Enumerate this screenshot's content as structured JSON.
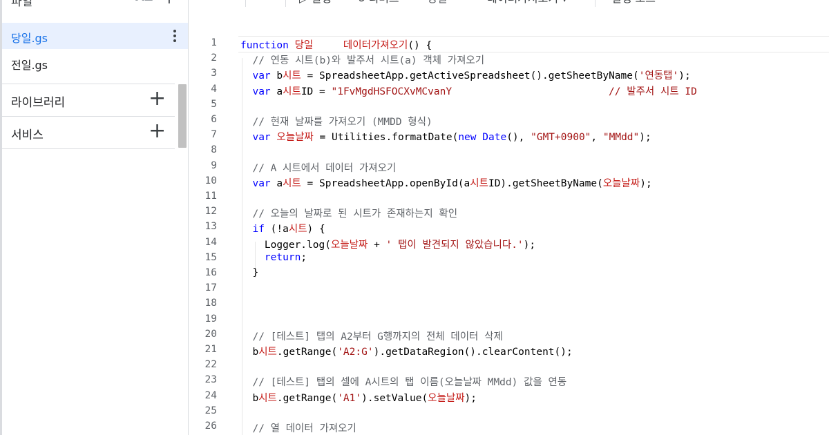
{
  "sidebar": {
    "files_label": "파일",
    "sort_label": "AZ",
    "add_label": "+",
    "files": [
      {
        "name": "당일.gs",
        "active": true
      },
      {
        "name": "전일.gs",
        "active": false
      }
    ],
    "sections": [
      {
        "name": "라이브러리",
        "add": "+"
      },
      {
        "name": "서비스",
        "add": "+"
      }
    ]
  },
  "toolbar": {
    "undo": "↶",
    "redo": "↷",
    "save": "⎙",
    "run": "▷ 실행",
    "debug": "⟲ 디버그",
    "bind": "평일",
    "function_select": "데이터가져오기 ▾",
    "log": "실행 로그"
  },
  "editor": {
    "current_line": 1,
    "lines": [
      {
        "n": "1",
        "code": "function 당일     데이터가져오기() {"
      },
      {
        "n": "2",
        "code": "  // 연동 시트(b)와 발주서 시트(a) 객체 가져오기"
      },
      {
        "n": "3",
        "code": "  var b시트 = SpreadsheetApp.getActiveSpreadsheet().getSheetByName('연동탭');"
      },
      {
        "n": "4",
        "code": "  var a시트ID = \"1FvMgdHSFOCXvMCvanY                          // 발주서 시트 ID"
      },
      {
        "n": "5",
        "code": ""
      },
      {
        "n": "6",
        "code": "  // 현재 날짜를 가져오기 (MMDD 형식)"
      },
      {
        "n": "7",
        "code": "  var 오늘날짜 = Utilities.formatDate(new Date(), \"GMT+0900\", \"MMdd\");"
      },
      {
        "n": "8",
        "code": ""
      },
      {
        "n": "9",
        "code": "  // A 시트에서 데이터 가져오기"
      },
      {
        "n": "10",
        "code": "  var a시트 = SpreadsheetApp.openById(a시트ID).getSheetByName(오늘날짜);"
      },
      {
        "n": "11",
        "code": ""
      },
      {
        "n": "12",
        "code": "  // 오늘의 날짜로 된 시트가 존재하는지 확인"
      },
      {
        "n": "13",
        "code": "  if (!a시트) {"
      },
      {
        "n": "14",
        "code": "    Logger.log(오늘날짜 + ' 탭이 발견되지 않았습니다.');"
      },
      {
        "n": "15",
        "code": "    return;"
      },
      {
        "n": "16",
        "code": "  }"
      },
      {
        "n": "17",
        "code": ""
      },
      {
        "n": "18",
        "code": ""
      },
      {
        "n": "19",
        "code": ""
      },
      {
        "n": "20",
        "code": "  // [테스트] 탭의 A2부터 G행까지의 전체 데이터 삭제"
      },
      {
        "n": "21",
        "code": "  b시트.getRange('A2:G').getDataRegion().clearContent();"
      },
      {
        "n": "22",
        "code": ""
      },
      {
        "n": "23",
        "code": "  // [테스트] 탭의 셀에 A시트의 탭 이름(오늘날짜 MMdd) 값을 연동"
      },
      {
        "n": "24",
        "code": "  b시트.getRange('A1').setValue(오늘날짜);"
      },
      {
        "n": "25",
        "code": ""
      },
      {
        "n": "26",
        "code": "  // 열 데이터 가져오기"
      }
    ]
  },
  "colors": {
    "keyword": "#0000ff",
    "string": "#a31515",
    "identifier": "#c41a16",
    "comment": "#5f6368",
    "method": "#000000",
    "active_file": "#1a73e8",
    "active_bg": "#e8f0fe"
  }
}
